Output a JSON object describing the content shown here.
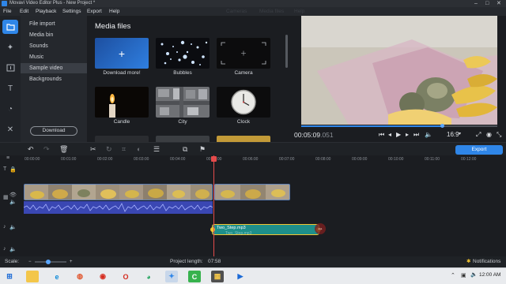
{
  "window": {
    "title": "Movavi Video Editor Plus - New Project *"
  },
  "menu": [
    "File",
    "Edit",
    "Playback",
    "Settings",
    "Export",
    "Help"
  ],
  "menu_ghost": [
    "Cameras",
    "Media files",
    "Help"
  ],
  "sidebar": {
    "items": [
      {
        "label": "File import"
      },
      {
        "label": "Media bin"
      },
      {
        "label": "Sounds"
      },
      {
        "label": "Music"
      },
      {
        "label": "Sample video"
      },
      {
        "label": "Backgrounds"
      }
    ],
    "selected": "Sample video",
    "download_label": "Download"
  },
  "media": {
    "header": "Media files",
    "tiles": [
      {
        "label": "Download more!",
        "icon": "plus-icon"
      },
      {
        "label": "Bubbles"
      },
      {
        "label": "Camera"
      },
      {
        "label": "Candle"
      },
      {
        "label": "City"
      },
      {
        "label": "Clock"
      }
    ]
  },
  "preview": {
    "timecode": "00:05:09",
    "timecode_frac": ".051",
    "aspect": "16:9",
    "progress": 0.72
  },
  "toolbar": {
    "export_label": "Export"
  },
  "ruler": [
    "00:00:00",
    "00:01:00",
    "00:02:00",
    "00:03:00",
    "00:04:00",
    "00:05:00",
    "00:06:00",
    "00:07:00",
    "00:08:00",
    "00:09:00",
    "00:10:00",
    "00:11:00",
    "00:12:00"
  ],
  "timeline": {
    "music_clip": "Two_Step.mp3",
    "music_clip_ghost": "Two_Step.mp3"
  },
  "status": {
    "scale_label": "Scale:",
    "project_length_label": "Project length:",
    "project_length": "07:58",
    "notifications": "Notifications"
  },
  "taskbar": {
    "time": "12:00 AM"
  },
  "colors": {
    "accent": "#2f86e8",
    "playhead": "#e54b4b",
    "music_clip": "#1e8f8a",
    "audio_wave": "#3a47b3"
  }
}
